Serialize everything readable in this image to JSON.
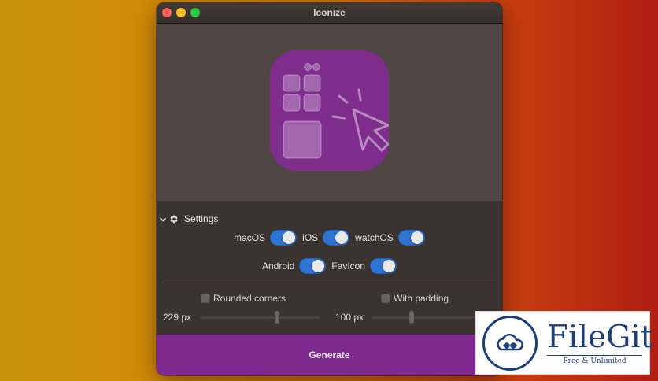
{
  "window": {
    "title": "Iconize"
  },
  "settings": {
    "header": "Settings",
    "platforms": [
      {
        "label": "macOS",
        "enabled": true
      },
      {
        "label": "iOS",
        "enabled": true
      },
      {
        "label": "watchOS",
        "enabled": true
      },
      {
        "label": "Android",
        "enabled": true
      },
      {
        "label": "FavIcon",
        "enabled": true
      }
    ],
    "rounded_corners": {
      "label": "Rounded corners",
      "checked": false,
      "value_label": "229 px"
    },
    "with_padding": {
      "label": "With padding",
      "checked": false,
      "value_label": "100 px"
    }
  },
  "generate": {
    "label": "Generate"
  },
  "watermark": {
    "brand": "FileGit",
    "tagline": "Free & Unlimited"
  },
  "colors": {
    "accent_toggle": "#2e74d3",
    "icon_background": "#7f2d8d",
    "generate_button": "#7f2a8e"
  },
  "icons": {
    "preview": "app-icon-grid-cursor",
    "settings": "gear-icon",
    "collapse": "chevron-down-icon"
  }
}
